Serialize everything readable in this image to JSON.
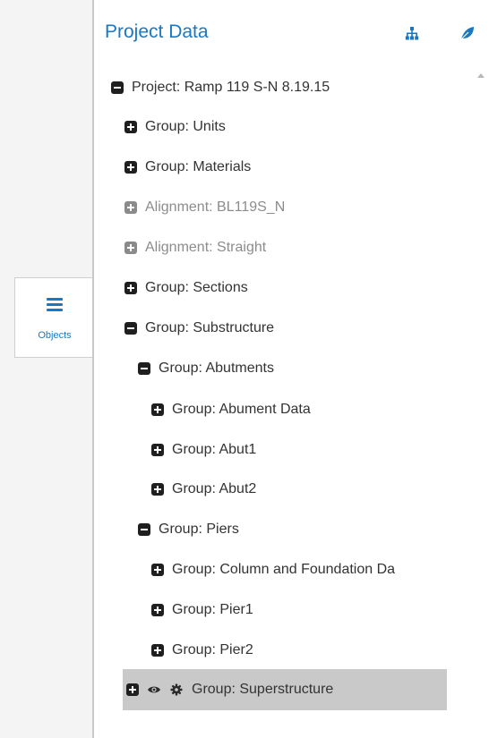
{
  "sidebar": {
    "objects_tab_label": "Objects",
    "objects_icon": "hamburger-menu-icon"
  },
  "panel": {
    "title": "Project Data",
    "header_icons": [
      "hierarchy-icon",
      "leaf-icon"
    ]
  },
  "tree": {
    "project": "Project: Ramp 119 S-N 8.19.15",
    "units": "Group: Units",
    "materials": "Group: Materials",
    "alignment_bl119": "Alignment: BL119S_N",
    "alignment_straight": "Alignment: Straight",
    "sections": "Group: Sections",
    "substructure": "Group: Substructure",
    "abutments": "Group: Abutments",
    "abutment_data": "Group: Abument Data",
    "abut1": "Group: Abut1",
    "abut2": "Group: Abut2",
    "piers": "Group: Piers",
    "column_foundation": "Group: Column and Foundation Da",
    "pier1": "Group: Pier1",
    "pier2": "Group: Pier2",
    "superstructure": "Group: Superstructure"
  },
  "colors": {
    "accent": "#1a78c2",
    "selected_row": "#c9c9c9",
    "dim_text": "#8c8c8c"
  }
}
